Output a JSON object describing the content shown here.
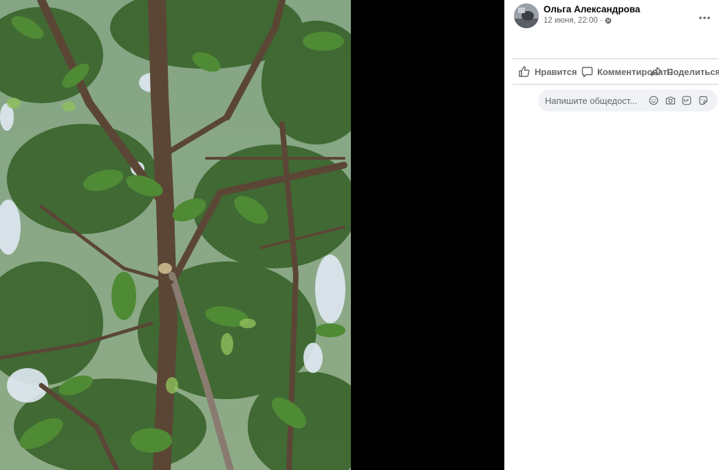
{
  "post": {
    "author": "Ольга Александрова",
    "date": "12 июня, 22:00",
    "separator": "·",
    "privacy_icon": "globe-icon",
    "more_icon": "more-horizontal-icon"
  },
  "actions": {
    "like_label": "Нравится",
    "comment_label": "Комментировать",
    "share_label": "Поделиться"
  },
  "comment_composer": {
    "placeholder": "Напишите общедост..."
  },
  "icons": [
    "like-icon",
    "comment-icon",
    "share-icon",
    "emoji-icon",
    "camera-icon",
    "gif-icon",
    "sticker-icon"
  ],
  "colors": {
    "viewer_bg": "#000000",
    "panel_bg": "#ffffff",
    "name_text": "#050505",
    "secondary_text": "#65676b",
    "composer_bg": "#f0f2f5",
    "divider": "#ced0d4"
  }
}
